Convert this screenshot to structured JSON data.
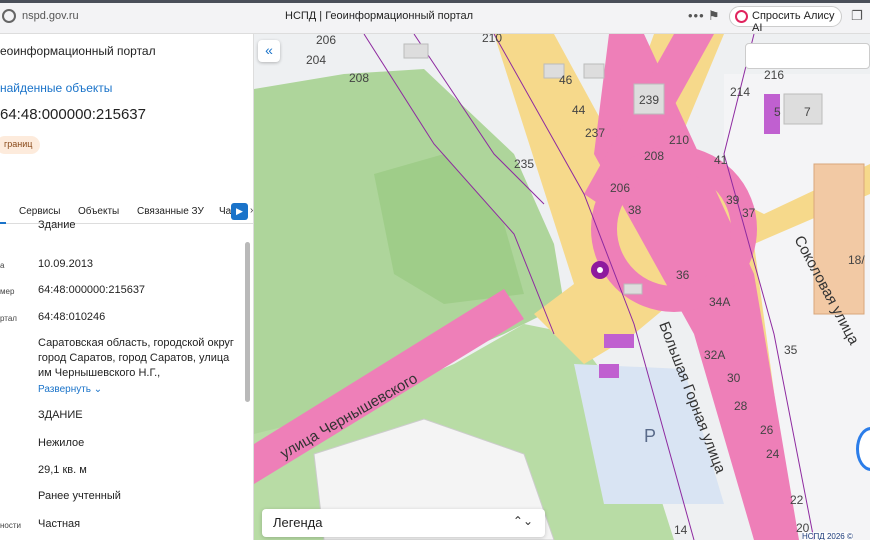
{
  "browser": {
    "url": "nspd.gov.ru",
    "tab_title": "НСПД | Геоинформационный портал",
    "ask_alice": "Спросить Алису AI"
  },
  "panel": {
    "portal_title": "еоинформационный портал",
    "found_link": "найденные объекты",
    "cad_number": "64:48:000000:215637",
    "badge": "границ",
    "tabs": [
      "Сервисы",
      "Объекты",
      "Связанные ЗУ",
      "Ча"
    ],
    "rows": [
      {
        "label": "",
        "value": "Здание"
      },
      {
        "label": "а",
        "value": "10.09.2013"
      },
      {
        "label": "мер",
        "value": "64:48:000000:215637"
      },
      {
        "label": "ртал",
        "value": "64:48:010246"
      },
      {
        "label": "",
        "value": "Саратовская область, городской округ город Саратов, город Саратов, улица им Чернышевского Н.Г.,"
      },
      {
        "label": "",
        "value": "ЗДАНИЕ"
      },
      {
        "label": "",
        "value": "Нежилое"
      },
      {
        "label": "",
        "value": "29,1 кв. м"
      },
      {
        "label": "",
        "value": "Ранее учтенный"
      },
      {
        "label": "ности",
        "value": "Частная"
      }
    ],
    "expand": "Развернуть"
  },
  "map": {
    "legend": "Легенда",
    "copyright": "НСПД 2026 ©",
    "streets": [
      "улица Чернышевского",
      "Большая Горная улица",
      "Соколовая улица"
    ],
    "parcel_numbers": [
      "206",
      "204",
      "208",
      "210",
      "46",
      "44",
      "237",
      "239",
      "216",
      "214",
      "5",
      "7",
      "235",
      "208",
      "210",
      "41",
      "206",
      "38",
      "39",
      "37",
      "36",
      "34А",
      "32А",
      "35",
      "30",
      "28",
      "26",
      "24",
      "22",
      "20",
      "14",
      "18/"
    ],
    "parking_label": "P"
  },
  "colors": {
    "accent": "#1a73c9",
    "pink": "#e85bd6",
    "park": "#aed59b",
    "marker": "#8e1a9e"
  }
}
